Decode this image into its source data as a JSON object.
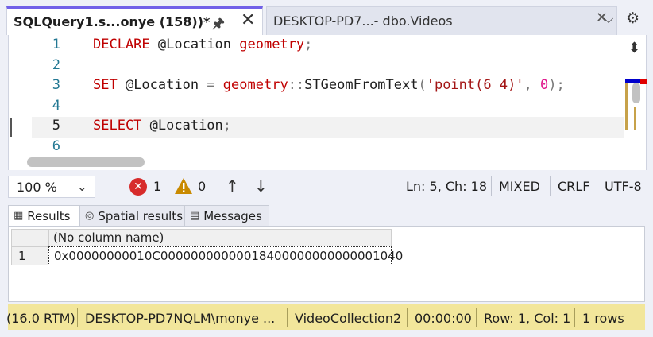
{
  "tabs": {
    "active_title": "SQLQuery1.s...onye (158))*",
    "inactive_title": "DESKTOP-PD7...- dbo.Videos"
  },
  "editor": {
    "lines": [
      {
        "num": "1",
        "tokens": [
          [
            "kw",
            "DECLARE"
          ],
          [
            "vr",
            " @Location "
          ],
          [
            "kw",
            "geometry"
          ],
          [
            "pu",
            ";"
          ]
        ]
      },
      {
        "num": "2",
        "tokens": []
      },
      {
        "num": "3",
        "tokens": [
          [
            "kw",
            "SET"
          ],
          [
            "vr",
            " @Location "
          ],
          [
            "pu",
            "= "
          ],
          [
            "kw",
            "geometry"
          ],
          [
            "pu",
            "::"
          ],
          [
            "fn",
            "STGeomFromText"
          ],
          [
            "pu",
            "("
          ],
          [
            "st",
            "'point(6 4)'"
          ],
          [
            "pu",
            ", "
          ],
          [
            "nm",
            "0"
          ],
          [
            "pu",
            ");"
          ]
        ]
      },
      {
        "num": "4",
        "tokens": []
      },
      {
        "num": "5",
        "tokens": [
          [
            "kw",
            "SELECT"
          ],
          [
            "vr",
            " @Location"
          ],
          [
            "pu",
            ";"
          ]
        ]
      },
      {
        "num": "6",
        "tokens": []
      }
    ],
    "current_line": "5"
  },
  "toolbar": {
    "zoom": "100 %",
    "errors": "1",
    "warnings": "0",
    "position": "Ln: 5, Ch: 18",
    "whitespace": "MIXED",
    "line_ending": "CRLF",
    "encoding": "UTF-8"
  },
  "results_tabs": {
    "results": "Results",
    "spatial": "Spatial results",
    "messages": "Messages"
  },
  "grid": {
    "column_header": "(No column name)",
    "row_number": "1",
    "cell_value": "0x00000000010C00000000000018400000000000001040"
  },
  "status": {
    "version": "(16.0 RTM)",
    "server": "DESKTOP-PD7NQLM\\monye ...",
    "database": "VideoCollection2",
    "elapsed": "00:00:00",
    "rowcol": "Row: 1, Col: 1",
    "rows": "1 rows"
  },
  "colors": {
    "accent": "#7160e8",
    "keyword": "#c00000",
    "string": "#a31515",
    "number": "#e0198d",
    "error": "#d72b2b",
    "warning": "#c98a00",
    "statusbar": "#f2e69b"
  }
}
